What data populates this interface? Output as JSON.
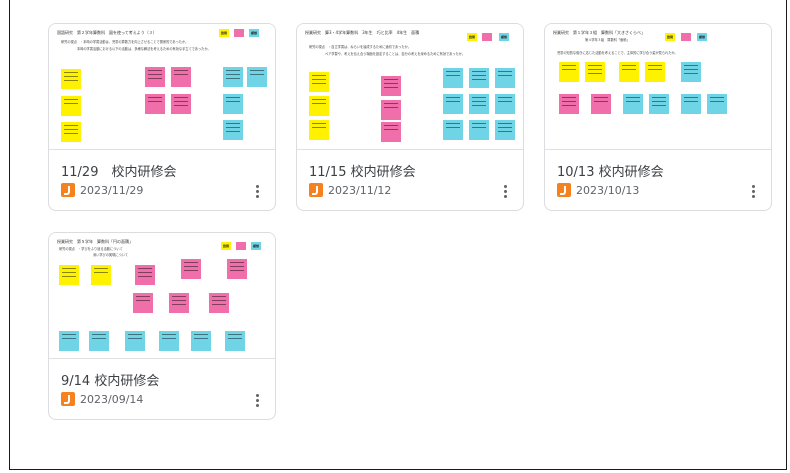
{
  "colors": {
    "yellow": "#fff200",
    "pink": "#f06ea9",
    "cyan": "#6fd5e6",
    "jamboard_orange": "#f5811f"
  },
  "boards": [
    {
      "title": "11/29　校内研修会",
      "date": "2023/11/29",
      "thumb_title": "国語研究　第２学年算数科　図を使って考えよう（３）",
      "thumb_sub1": "研究の視点　・本時の学習活動は、児童の算数力を向上させることで関係的であったか。",
      "thumb_sub2": "本時の学習活動における以下の活動は、多様な解法を考えるための有効な手立てであったか。",
      "tags": [
        "質問",
        "",
        "感想"
      ],
      "icon": "jamboard-icon"
    },
    {
      "title": "11/15 校内研修会",
      "date": "2023/11/12",
      "thumb_title": "授業研究　算3・4学年算数科　3年生　巧と比率　4年生　面積",
      "thumb_sub1": "研究の視点　・自立学習は、ねらいを達成するために適切であったか。",
      "thumb_sub2": "ペア学習や、考えを伝え合う場面を設定することは、自分の考えを深めるために有効であったか。",
      "tags": [
        "質問",
        "",
        "感想"
      ],
      "icon": "jamboard-icon"
    },
    {
      "title": "10/13 校内研修会",
      "date": "2023/10/13",
      "thumb_title": "授業研究　第１学年３組　算数科「大きさくらべ」",
      "thumb_sub1": "第４学年３組　算数科「面積」",
      "thumb_sub2": "児童の知的な働きに応じた活動を考えることで、主体的に学び合う姿が見られたか。",
      "tags": [
        "質問",
        "",
        "感想"
      ],
      "icon": "jamboard-icon"
    },
    {
      "title": "9/14 校内研修会",
      "date": "2023/09/14",
      "thumb_title": "授業研究　第５学年　算数科「円の面積」",
      "thumb_sub1": "研究の視点　・学びをふり返る活動について",
      "thumb_sub2": "深い学びの実現について",
      "tags": [
        "質問",
        "",
        "感想"
      ],
      "icon": "jamboard-icon"
    }
  ]
}
